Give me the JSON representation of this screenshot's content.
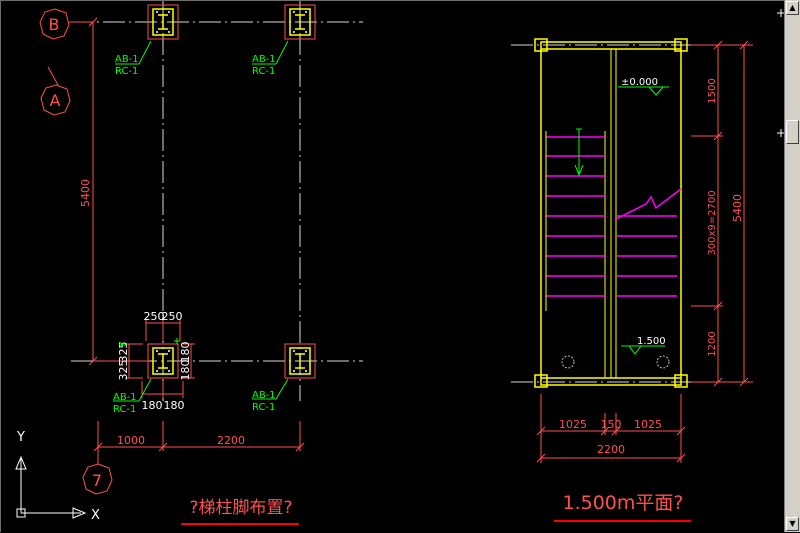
{
  "left_plan": {
    "grid_bubbles": {
      "top": "B",
      "second": "A",
      "bottom": "7"
    },
    "dim_vertical_total": "5400",
    "dim_bottom_first": "1000",
    "dim_bottom_second": "2200",
    "base_dims_top": [
      "250",
      "250"
    ],
    "base_dims_left": [
      "325",
      "325"
    ],
    "base_dims_right": [
      "180",
      "180"
    ],
    "base_dims_bottom": [
      "180",
      "180"
    ],
    "column_tags": [
      {
        "line1": "AB-1",
        "line2": "RC-1"
      },
      {
        "line1": "AB-1",
        "line2": "RC-1"
      },
      {
        "line1": "AB-1",
        "line2": "RC-1"
      },
      {
        "line1": "AB-1",
        "line2": "RC-1"
      }
    ],
    "caption": "?梯柱脚布置?"
  },
  "right_plan": {
    "level_top": "±0.000",
    "level_landing": "1.500",
    "dim_right_segments": [
      "1500",
      "300x9=2700",
      "1200"
    ],
    "dim_right_total": "5400",
    "dim_bottom_segments": [
      "1025",
      "150",
      "1025"
    ],
    "dim_bottom_total": "2200",
    "caption": "1.500m平面?"
  },
  "ucs": {
    "x_label": "X",
    "y_label": "Y"
  },
  "colors": {
    "background": "#000000",
    "grid_line": "#ffffff",
    "dimension": "#ff5050",
    "column": "#ffff00",
    "tag": "#00ff00",
    "treads": "#ff00ff",
    "caption_underline": "#ff0000"
  },
  "scrollbar": {
    "up_icon": "▲",
    "down_icon": "▼"
  }
}
